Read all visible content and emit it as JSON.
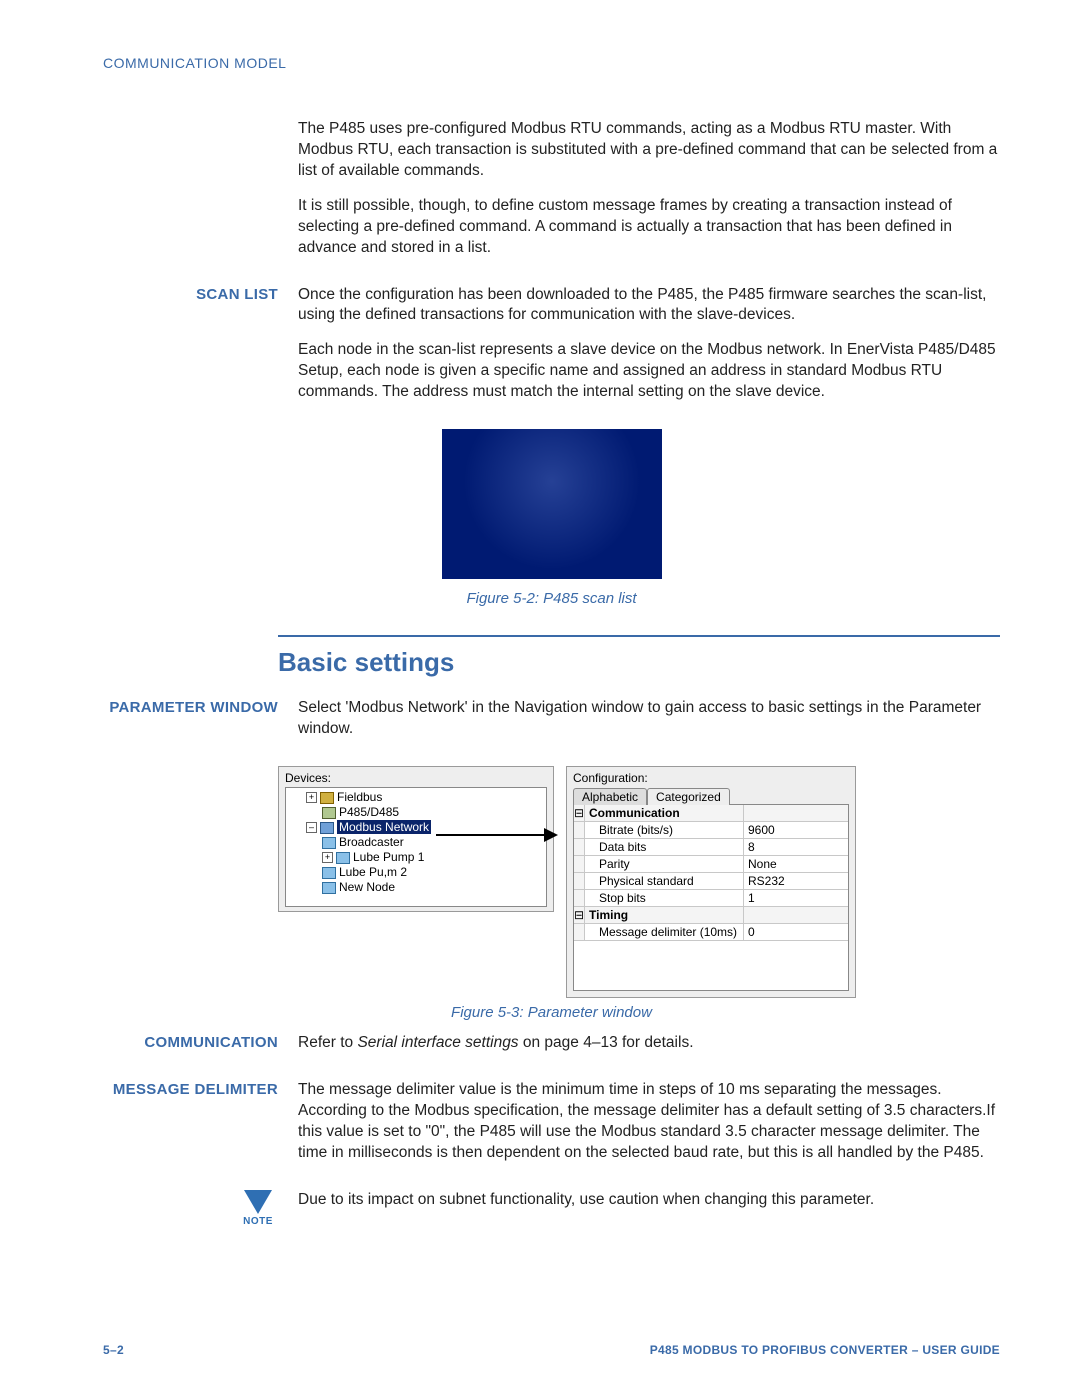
{
  "header": {
    "title": "COMMUNICATION MODEL"
  },
  "intro": {
    "p1": "The P485 uses pre-configured Modbus RTU commands, acting as a Modbus RTU master. With Modbus RTU, each transaction is substituted with a pre-defined command that can be selected from a list of available commands.",
    "p2": "It is still possible, though, to define custom message frames by creating a transaction instead of selecting a pre-defined command. A command is actually a transaction that has been defined in advance and stored in a list."
  },
  "scan_list": {
    "label": "SCAN LIST",
    "p1": "Once the configuration has been downloaded to the P485, the P485 firmware searches the scan-list, using the defined transactions for communication with the slave-devices.",
    "p2": "Each node in the scan-list represents a slave device on the Modbus network. In EnerVista P485/D485 Setup, each node is given a specific name and assigned an address in standard Modbus RTU commands. The address must match the internal setting on the slave device."
  },
  "fig1_caption": "Figure 5-2: P485 scan list",
  "basic_settings_heading": "Basic settings",
  "param_window": {
    "label": "PARAMETER WINDOW",
    "p1": "Select 'Modbus Network' in the Navigation window to gain access to basic settings in the Parameter window."
  },
  "devices": {
    "label": "Devices:",
    "tree": {
      "root1": "Fieldbus",
      "root1_child": "P485/D485",
      "root2": "Modbus Network",
      "root2_children": [
        "Broadcaster",
        "Lube Pump 1",
        "Lube Pu,m 2",
        "New Node"
      ]
    }
  },
  "config": {
    "label": "Configuration:",
    "tabs": [
      "Alphabetic",
      "Categorized"
    ],
    "groups": [
      {
        "name": "Communication",
        "rows": [
          {
            "k": "Bitrate (bits/s)",
            "v": "9600"
          },
          {
            "k": "Data bits",
            "v": "8"
          },
          {
            "k": "Parity",
            "v": "None"
          },
          {
            "k": "Physical standard",
            "v": "RS232"
          },
          {
            "k": "Stop bits",
            "v": "1"
          }
        ]
      },
      {
        "name": "Timing",
        "rows": [
          {
            "k": "Message delimiter (10ms)",
            "v": "0"
          }
        ]
      }
    ]
  },
  "fig2_caption": "Figure 5-3: Parameter window",
  "communication": {
    "label": "COMMUNICATION",
    "text_pre": "Refer to ",
    "text_em": "Serial interface settings",
    "text_post": " on page 4–13 for details."
  },
  "message_delimiter": {
    "label": "MESSAGE DELIMITER",
    "p1": "The message delimiter value is the minimum time in steps of 10 ms separating the messages. According to the Modbus specification, the message delimiter has a default setting of 3.5 characters.If this value is set to \"0\", the P485 will use the Modbus standard 3.5 character message delimiter. The time in milliseconds is then dependent on the selected baud rate, but this is all handled by the P485.",
    "note_label": "NOTE",
    "note_text": "Due to its impact on subnet functionality, use caution when changing this parameter."
  },
  "footer": {
    "left": "5–2",
    "right": "P485 MODBUS TO PROFIBUS CONVERTER – USER GUIDE"
  }
}
